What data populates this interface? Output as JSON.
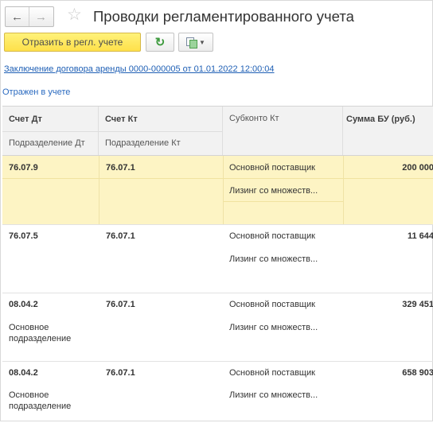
{
  "window": {
    "title": "Проводки регламентированного учета",
    "nav_back": "←",
    "nav_forward": "→",
    "favorite": "☆"
  },
  "toolbar": {
    "post_label": "Отразить в регл. учете",
    "refresh_icon": "refresh-icon",
    "menu_icon": "documents-icon"
  },
  "document_link": "Заключение договора аренды 0000-000005 от 01.01.2022 12:00:04",
  "status_text": "Отражен в учете",
  "table": {
    "headers": {
      "debit_account": "Счет Дт",
      "credit_account": "Счет Кт",
      "subconto_credit": "Субконто Кт",
      "amount_bu": "Сумма БУ (руб.)",
      "division_debit": "Подразделение Дт",
      "division_credit": "Подразделение Кт"
    },
    "rows": [
      {
        "debit_account": "76.07.9",
        "credit_account": "76.07.1",
        "subconto_1": "Основной поставщик",
        "subconto_2": "Лизинг со множеств...",
        "amount": "200 000",
        "division_debit": "",
        "selected": true
      },
      {
        "debit_account": "76.07.5",
        "credit_account": "76.07.1",
        "subconto_1": "Основной поставщик",
        "subconto_2": "Лизинг со множеств...",
        "amount": "11 644",
        "division_debit": "",
        "selected": false
      },
      {
        "debit_account": "08.04.2",
        "credit_account": "76.07.1",
        "subconto_1": "Основной поставщик",
        "subconto_2": "Лизинг со множеств...",
        "amount": "329 451",
        "division_debit": "Основное подразделение",
        "selected": false
      },
      {
        "debit_account": "08.04.2",
        "credit_account": "76.07.1",
        "subconto_1": "Основной поставщик",
        "subconto_2": "Лизинг со множеств...",
        "amount": "658 903",
        "division_debit": "Основное подразделение",
        "selected": false
      }
    ]
  },
  "colors": {
    "accent_button": "#fee04a",
    "selected_row": "#fdf4c4",
    "link": "#1e5fb5"
  }
}
